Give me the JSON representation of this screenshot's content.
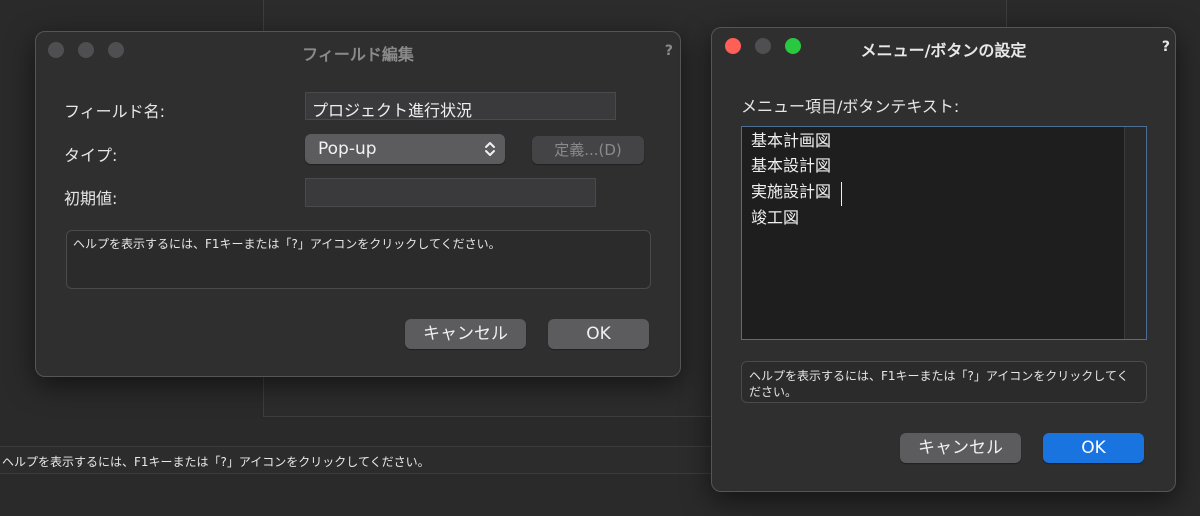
{
  "background": {
    "status_text": "ヘルプを表示するには、F1キーまたは「?」アイコンをクリックしてください。"
  },
  "field_dialog": {
    "title": "フィールド編集",
    "help_icon": "?",
    "name_label": "フィールド名:",
    "name_value": "プロジェクト進行状況",
    "type_label": "タイプ:",
    "type_value": "Pop-up",
    "define_button": "定義...(D)",
    "initial_label": "初期値:",
    "initial_value": "",
    "help_text": "ヘルプを表示するには、F1キーまたは「?」アイコンをクリックしてください。",
    "cancel_label": "キャンセル",
    "ok_label": "OK"
  },
  "menu_dialog": {
    "title": "メニュー/ボタンの設定",
    "help_icon": "?",
    "list_label": "メニュー項目/ボタンテキスト:",
    "items": [
      "基本計画図",
      "基本設計図",
      "実施設計図",
      "竣工図"
    ],
    "help_text": "ヘルプを表示するには、F1キーまたは「?」アイコンをクリックしてください。",
    "cancel_label": "キャンセル",
    "ok_label": "OK"
  },
  "colors": {
    "accent": "#1a74e0",
    "close": "#fe5f57",
    "minimize": "#febc2e",
    "zoom": "#28c840",
    "inactive_light": "#4f4f51"
  }
}
